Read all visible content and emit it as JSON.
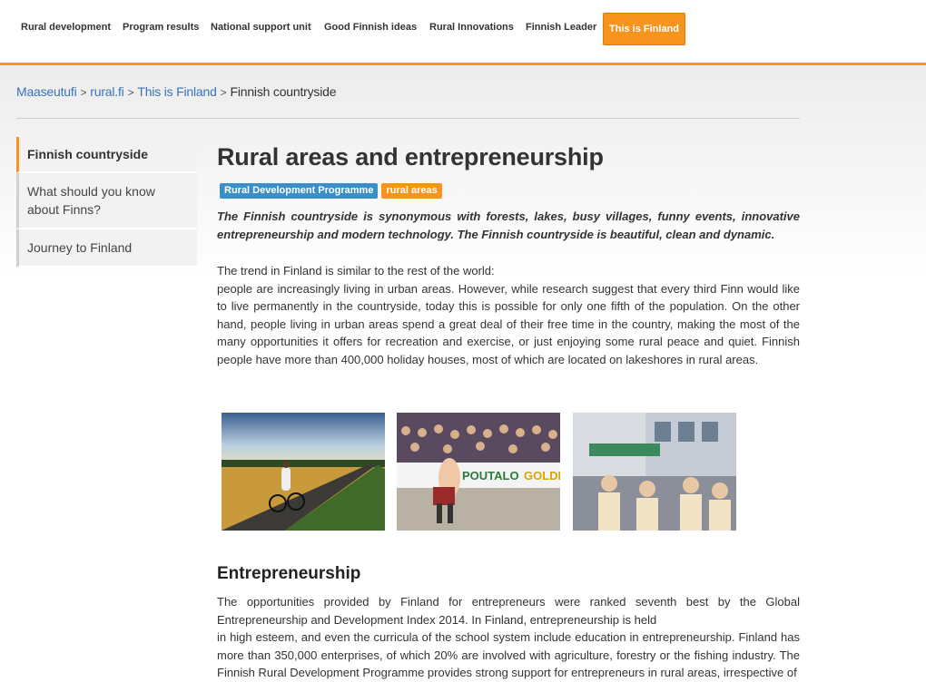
{
  "nav": {
    "items": [
      "Rural development",
      "Program results",
      "National support unit",
      "Good Finnish ideas",
      "Rural Innovations",
      "Finnish Leader",
      "This is Finland"
    ],
    "active_index": 6
  },
  "breadcrumb": {
    "items": [
      "Maaseutufi",
      "rural.fi",
      "This is Finland",
      "Finnish countryside"
    ]
  },
  "sidebar": {
    "items": [
      "Finnish countryside",
      "What should you know about Finns?",
      "Journey to Finland"
    ],
    "active_index": 0
  },
  "article": {
    "title": "Rural areas and entrepreneurship",
    "tags": [
      "Rural Development Programme",
      "rural areas"
    ],
    "lead": "The Finnish countryside is synonymous with forests, lakes, busy villages, funny events, innovative entrepreneurship and modern technology. The Finnish countryside is beautiful, clean and dynamic.",
    "para1_line1": "The trend in Finland is similar to the rest of the world:",
    "para1_rest": "people are increasingly living in urban areas. However, while research suggest that every third Finn would like to live permanently in the countryside, today this is possible for only one fifth of the population. On the other hand, people living in urban areas spend a great deal of their free time in the country, making the most of the many opportunities it offers for recreation and exercise, or just enjoying some rural peace and quiet. Finnish people have more than 400,000 holiday houses, most of which are located on lakeshores in rural areas.",
    "section_heading": "Entrepreneurship",
    "para2_line1": "The opportunities provided by Finland for entrepreneurs were ranked seventh best by the Global Entrepreneurship and Development Index 2014. In Finland, entrepreneurship is held",
    "para2_rest": "in high esteem, and even the curricula of the school system include education in entrepreneurship. Finland has more than 350,000 enterprises, of which 20% are involved with agriculture, forestry or the fishing industry. The Finnish Rural Development Programme provides strong support for entrepreneurs in rural areas, irrespective of"
  },
  "photos": {
    "banner_texts": [
      "POUTALO",
      "GOLDEN"
    ]
  },
  "colors": {
    "accent": "#f7941d",
    "link": "#3b73b9",
    "tag_blue": "#3b8fc9"
  }
}
